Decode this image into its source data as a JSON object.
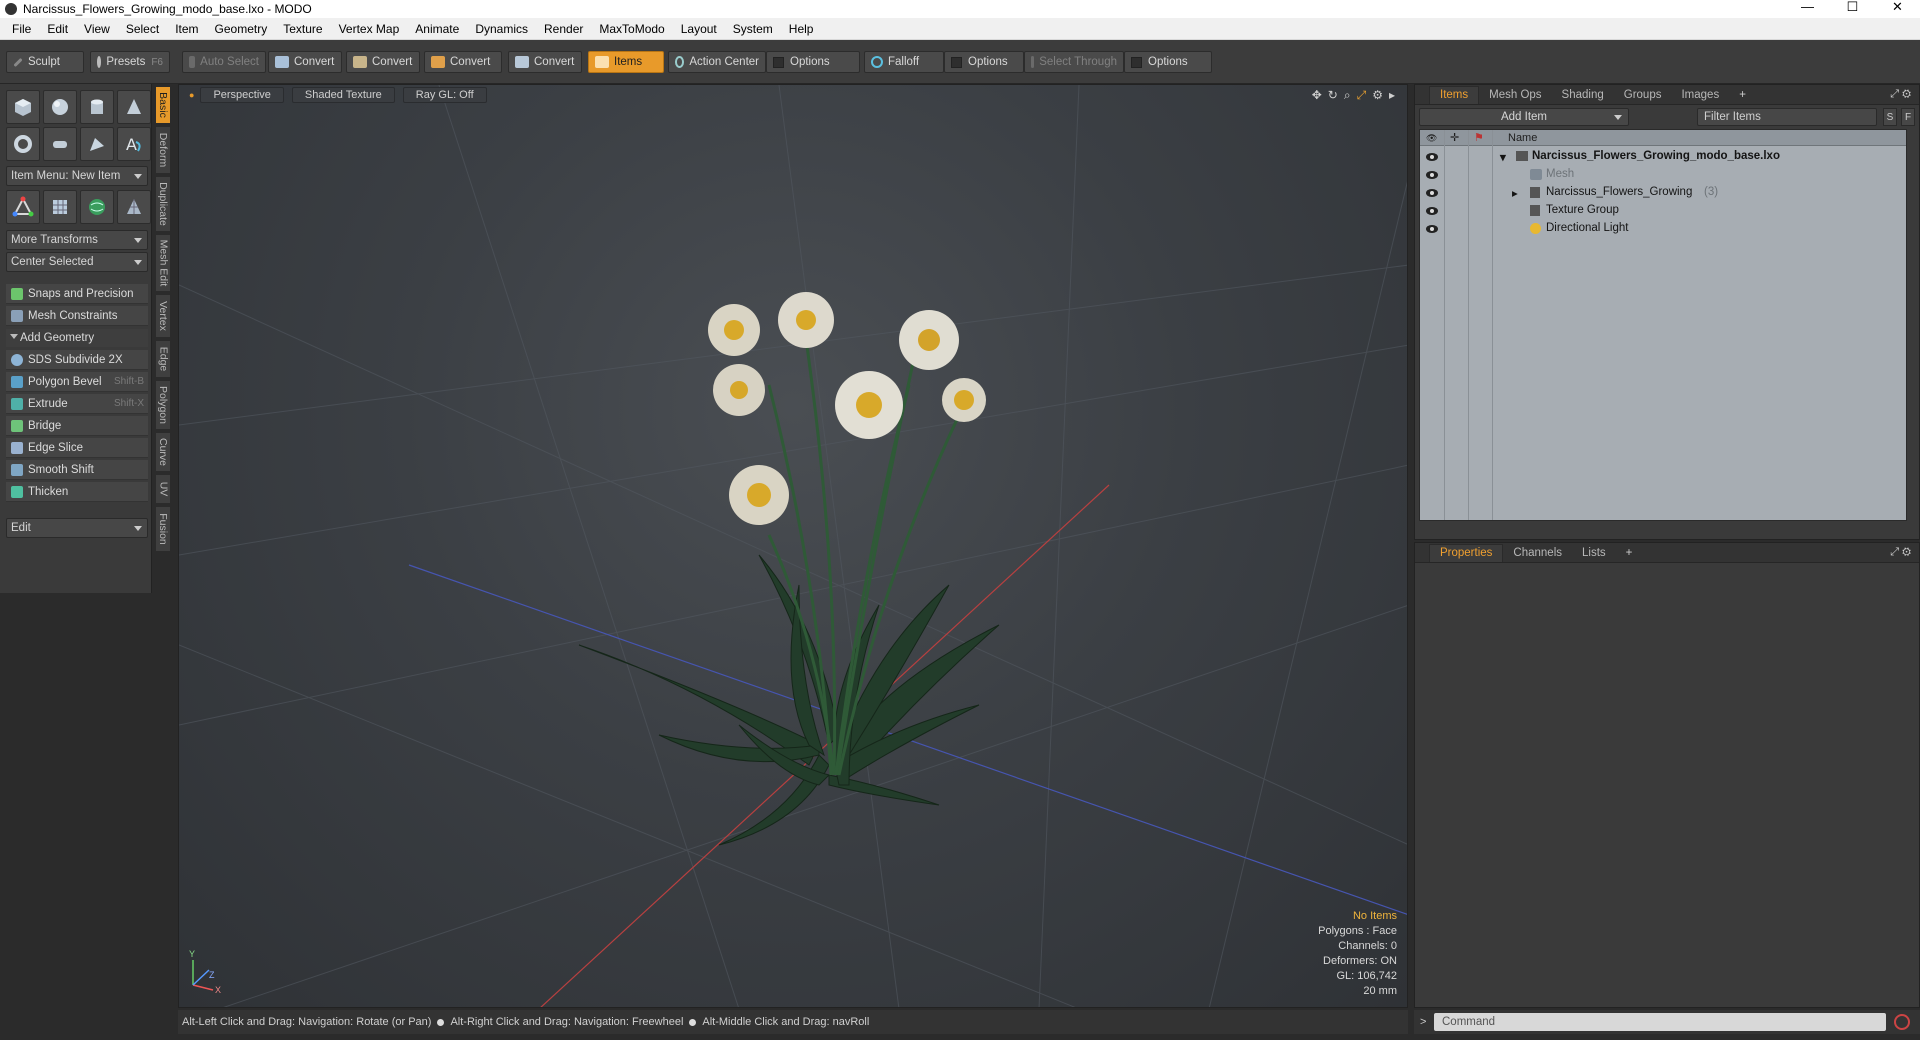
{
  "window": {
    "title": "Narcissus_Flowers_Growing_modo_base.lxo - MODO",
    "minimize": "—",
    "maximize": "☐",
    "close": "✕"
  },
  "menu": [
    "File",
    "Edit",
    "View",
    "Select",
    "Item",
    "Geometry",
    "Texture",
    "Vertex Map",
    "Animate",
    "Dynamics",
    "Render",
    "MaxToModo",
    "Layout",
    "System",
    "Help"
  ],
  "toolbar": {
    "sculpt": "Sculpt",
    "presets": "Presets",
    "presets_key": "F6",
    "auto_select": "Auto Select",
    "convert1": "Convert",
    "convert2": "Convert",
    "convert3": "Convert",
    "convert4": "Convert",
    "items": "Items",
    "action_center": "Action Center",
    "options1": "Options",
    "falloff": "Falloff",
    "options2": "Options",
    "select_through": "Select Through",
    "options3": "Options"
  },
  "left": {
    "item_menu": "Item Menu: New Item",
    "more_transforms": "More Transforms",
    "center_selected": "Center Selected",
    "snaps": "Snaps and Precision",
    "mesh_constraints": "Mesh Constraints",
    "add_geometry": "Add Geometry",
    "tools": [
      {
        "label": "SDS Subdivide 2X",
        "shortcut": ""
      },
      {
        "label": "Polygon Bevel",
        "shortcut": "Shift-B"
      },
      {
        "label": "Extrude",
        "shortcut": "Shift-X"
      },
      {
        "label": "Bridge",
        "shortcut": ""
      },
      {
        "label": "Edge Slice",
        "shortcut": ""
      },
      {
        "label": "Smooth Shift",
        "shortcut": ""
      },
      {
        "label": "Thicken",
        "shortcut": ""
      }
    ],
    "edit": "Edit"
  },
  "vtabs": [
    "Basic",
    "Deform",
    "Duplicate",
    "Mesh Edit",
    "Vertex",
    "Edge",
    "Polygon",
    "Curve",
    "UV",
    "Fusion"
  ],
  "viewport": {
    "perspective": "Perspective",
    "shaded": "Shaded Texture",
    "raygl": "Ray GL: Off",
    "stats": {
      "no_items": "No Items",
      "polygons": "Polygons : Face",
      "channels": "Channels: 0",
      "deformers": "Deformers: ON",
      "gl": "GL: 106,742",
      "scale": "20 mm"
    },
    "axis_y": "Y",
    "axis_x": "X",
    "axis_z": "Z"
  },
  "status": {
    "hint1": "Alt-Left Click and Drag: Navigation: Rotate (or Pan)",
    "hint2": "Alt-Right Click and Drag: Navigation: Freewheel",
    "hint3": "Alt-Middle Click and Drag: navRoll"
  },
  "items_panel": {
    "tabs": [
      "Items",
      "Mesh Ops",
      "Shading",
      "Groups",
      "Images"
    ],
    "plus": "+",
    "add_item": "Add Item",
    "filter": "Filter Items",
    "s": "S",
    "f": "F",
    "col_name": "Name",
    "rows": [
      {
        "label": "Narcissus_Flowers_Growing_modo_base.lxo",
        "count": ""
      },
      {
        "label": "Mesh",
        "count": ""
      },
      {
        "label": "Narcissus_Flowers_Growing",
        "count": "(3)"
      },
      {
        "label": "Texture Group",
        "count": ""
      },
      {
        "label": "Directional Light",
        "count": ""
      }
    ]
  },
  "props_panel": {
    "tabs": [
      "Properties",
      "Channels",
      "Lists"
    ],
    "plus": "+"
  },
  "command": {
    "placeholder": "Command",
    "prompt": ">"
  }
}
